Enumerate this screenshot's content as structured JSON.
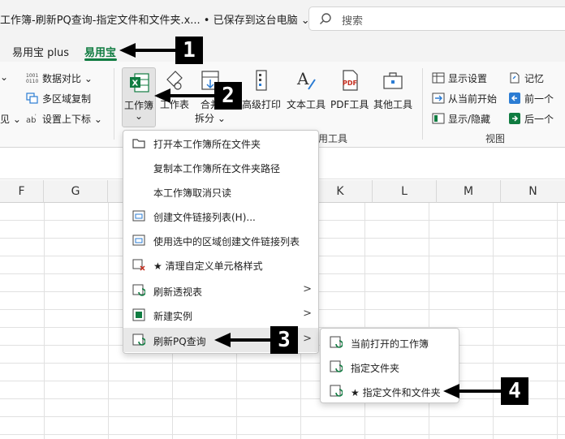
{
  "titlebar": {
    "title": "工作簿-刷新PQ查询-指定文件和文件夹.x... • 已保存到这台电脑 ⌄",
    "search_placeholder": "搜索"
  },
  "tabs": [
    {
      "label": "易用宝 plus"
    },
    {
      "label": "易用宝"
    }
  ],
  "ribbon": {
    "left_small": {
      "data_compare": "数据对比 ⌄",
      "multi_area_copy": "多区域复制",
      "set_up_down": "设置上下标 ⌄",
      "edge_item": "见 ⌄"
    },
    "large_buttons": {
      "workbook": "工作簿",
      "worksheet": "工作表",
      "merge_split_top": "合并",
      "merge_split_bottom": "拆分 ⌄",
      "advanced_print": "高级打印",
      "text_tools": "文本工具",
      "pdf_tools": "PDF工具",
      "other_tools": "其他工具"
    },
    "group_label_tools": "用工具",
    "view_group": {
      "display_settings": "显示设置",
      "from_current": "从当前开始",
      "show_hide": "显示/隐藏",
      "remember": "记忆",
      "prev": "前一个",
      "next": "后一个",
      "label": "视图"
    }
  },
  "columns": [
    "F",
    "G",
    "K",
    "L",
    "M",
    "N"
  ],
  "workbook_menu": {
    "items": [
      {
        "label": "打开本工作簿所在文件夹"
      },
      {
        "label": "复制本工作簿所在文件夹路径"
      },
      {
        "label": "本工作簿取消只读"
      },
      {
        "label": "创建文件链接列表(H)..."
      },
      {
        "label": "使用选中的区域创建文件链接列表"
      },
      {
        "label": "★ 清理自定义单元格样式"
      },
      {
        "label": "刷新透视表"
      },
      {
        "label": "新建实例"
      },
      {
        "label": "刷新PQ查询"
      }
    ]
  },
  "pq_submenu": {
    "items": [
      {
        "label": "当前打开的工作簿"
      },
      {
        "label": "指定文件夹"
      },
      {
        "label": "★ 指定文件和文件夹"
      }
    ]
  },
  "callouts": [
    "1",
    "2",
    "3",
    "4"
  ],
  "colors": {
    "accent_green": "#107c41",
    "callout_black": "#000000"
  }
}
